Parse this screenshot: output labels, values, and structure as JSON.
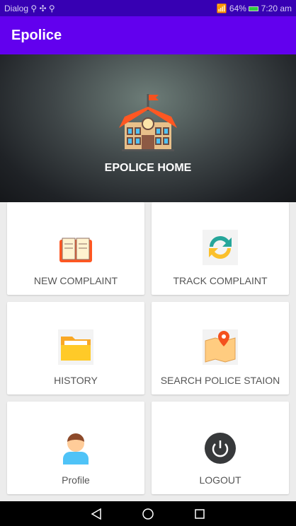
{
  "status": {
    "left": "Dialog ⚲ ✣ ⚲",
    "battery": "64%",
    "time": "7:20 am"
  },
  "appbar": {
    "title": "Epolice"
  },
  "hero": {
    "title": "EPOLICE HOME"
  },
  "cards": [
    {
      "label": "NEW COMPLAINT",
      "icon": "book-icon"
    },
    {
      "label": "TRACK COMPLAINT",
      "icon": "refresh-icon"
    },
    {
      "label": "HISTORY",
      "icon": "folder-icon"
    },
    {
      "label": "SEARCH POLICE STAION",
      "icon": "map-pin-icon"
    },
    {
      "label": "Profile",
      "icon": "user-icon"
    },
    {
      "label": "LOGOUT",
      "icon": "power-icon"
    }
  ],
  "colors": {
    "primary": "#6200ee",
    "primary_dark": "#3700b3"
  }
}
